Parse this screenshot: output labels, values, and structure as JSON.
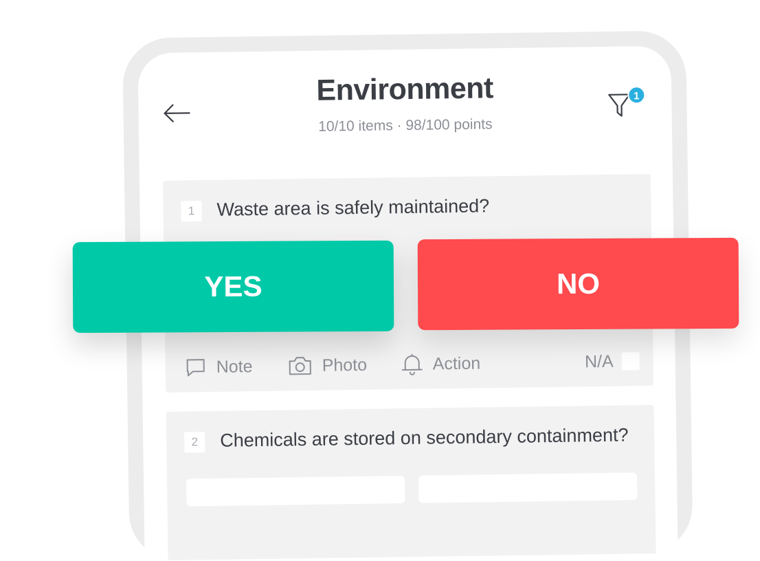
{
  "header": {
    "title": "Environment",
    "subtitle": "10/10 items · 98/100 points",
    "filter_badge": "1"
  },
  "questions": [
    {
      "number": "1",
      "text": "Waste area is safely maintained?",
      "actions": {
        "note": "Note",
        "photo": "Photo",
        "action": "Action",
        "na": "N/A"
      }
    },
    {
      "number": "2",
      "text": "Chemicals are stored on secondary containment?"
    }
  ],
  "answers": {
    "yes": "YES",
    "no": "NO"
  },
  "colors": {
    "yes": "#00c9a7",
    "no": "#ff4a4e",
    "badge": "#2ab0e0",
    "card": "#f2f2f2"
  },
  "icons": {
    "back": "arrow-left-icon",
    "filter": "funnel-icon",
    "note": "comment-icon",
    "photo": "camera-icon",
    "action": "bell-icon"
  }
}
